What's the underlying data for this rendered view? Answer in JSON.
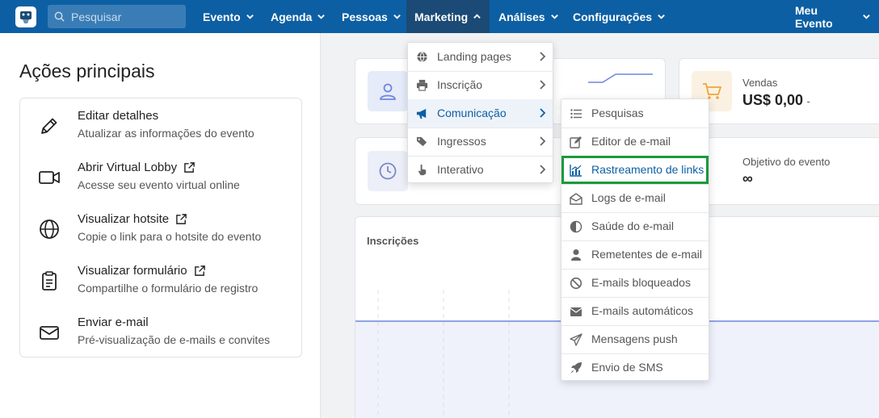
{
  "nav": {
    "search_placeholder": "Pesquisar",
    "items": [
      {
        "label": "Evento"
      },
      {
        "label": "Agenda"
      },
      {
        "label": "Pessoas"
      },
      {
        "label": "Marketing"
      },
      {
        "label": "Análises"
      },
      {
        "label": "Configurações"
      }
    ],
    "right_label": "Meu Evento"
  },
  "left": {
    "title": "Ações principais",
    "actions": [
      {
        "title": "Editar detalhes",
        "subtitle": "Atualizar as informações do evento",
        "icon": "pencil-icon"
      },
      {
        "title": "Abrir Virtual Lobby",
        "subtitle": "Acesse seu evento virtual online",
        "icon": "video-camera-icon"
      },
      {
        "title": "Visualizar hotsite",
        "subtitle": "Copie o link para o hotsite do evento",
        "icon": "globe-icon"
      },
      {
        "title": "Visualizar formulário",
        "subtitle": "Compartilhe o formulário de registro",
        "icon": "clipboard-icon"
      },
      {
        "title": "Enviar e-mail",
        "subtitle": "Pré-visualização de e-mails e convites",
        "icon": "envelope-icon"
      }
    ]
  },
  "stats": {
    "sales_label": "Vendas",
    "sales_value": "US$ 0,00",
    "sales_suffix": "-",
    "goal_label": "Objetivo do evento",
    "goal_value": "∞"
  },
  "chart": {
    "title": "Inscrições"
  },
  "marketing_menu": [
    {
      "label": "Landing pages",
      "icon": "globe-icon"
    },
    {
      "label": "Inscrição",
      "icon": "printer-icon"
    },
    {
      "label": "Comunicação",
      "icon": "megaphone-icon"
    },
    {
      "label": "Ingressos",
      "icon": "tags-icon"
    },
    {
      "label": "Interativo",
      "icon": "hand-pointer-icon"
    }
  ],
  "communication_menu": [
    {
      "label": "Pesquisas",
      "icon": "list-icon"
    },
    {
      "label": "Editor de e-mail",
      "icon": "edit-icon"
    },
    {
      "label": "Rastreamento de links",
      "icon": "chart-line-icon"
    },
    {
      "label": "Logs de e-mail",
      "icon": "envelope-open-icon"
    },
    {
      "label": "Saúde do e-mail",
      "icon": "half-circle-icon"
    },
    {
      "label": "Remetentes de e-mail",
      "icon": "user-icon"
    },
    {
      "label": "E-mails bloqueados",
      "icon": "ban-icon"
    },
    {
      "label": "E-mails automáticos",
      "icon": "envelope-icon"
    },
    {
      "label": "Mensagens push",
      "icon": "paper-plane-icon"
    },
    {
      "label": "Envio de SMS",
      "icon": "rocket-icon"
    }
  ],
  "colors": {
    "nav_bg": "#0d5fa3",
    "nav_active": "#1a4a75",
    "highlight_border": "#1b9a3a",
    "chart_line": "#6f86e0"
  }
}
